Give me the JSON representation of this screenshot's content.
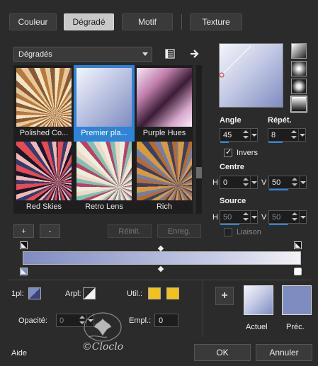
{
  "tabs": [
    {
      "label": "Couleur",
      "active": false
    },
    {
      "label": "Dégradé",
      "active": true
    },
    {
      "label": "Motif",
      "active": false
    },
    {
      "label": "Texture",
      "active": false
    }
  ],
  "library": {
    "dropdown_value": "Dégradés",
    "thumbnails": [
      {
        "label": "Polished Co...",
        "selected": false
      },
      {
        "label": "Premier pla...",
        "selected": true
      },
      {
        "label": "Purple Hues",
        "selected": false
      },
      {
        "label": "Red Skies",
        "selected": false
      },
      {
        "label": "Retro Lens",
        "selected": false
      },
      {
        "label": "Rich",
        "selected": false
      }
    ],
    "add_label": "+",
    "remove_label": "-",
    "reset_label": "Réinit.",
    "save_label": "Enreg."
  },
  "settings": {
    "angle_label": "Angle",
    "angle_value": "45",
    "repeat_label": "Répét.",
    "repeat_value": "8",
    "invert_label": "Invers",
    "invert_checked": true,
    "center_label": "Centre",
    "center_h_label": "H",
    "center_h_value": "0",
    "center_v_label": "V",
    "center_v_value": "50",
    "source_label": "Source",
    "source_h_label": "H",
    "source_h_value": "50",
    "source_v_label": "V",
    "source_v_value": "50",
    "link_label": "Liaison"
  },
  "editor": {
    "first_label": "1pl:",
    "arpl_label": "Arpl:",
    "util_label": "Util.:",
    "opacity_label": "Opacité:",
    "opacity_value": "0",
    "empl_label": "Empl.:",
    "empl_value": "0",
    "add_swatch_label": "+",
    "current_label": "Actuel",
    "previous_label": "Préc."
  },
  "footer": {
    "help_label": "Aide",
    "ok_label": "OK",
    "cancel_label": "Annuler",
    "watermark": "©Cloclo"
  },
  "colors": {
    "accent": "#2f84d8",
    "util_swatch": "#f2c21a",
    "gradient_start": "#7f8cbf",
    "gradient_end": "#f2f2f6",
    "previous_swatch": "#7f8cbf"
  },
  "icons": [
    "book-icon",
    "arrow-right-icon",
    "style-linear-icon",
    "style-rect-icon",
    "style-sunburst-icon",
    "style-radial-icon",
    "plus-icon"
  ]
}
